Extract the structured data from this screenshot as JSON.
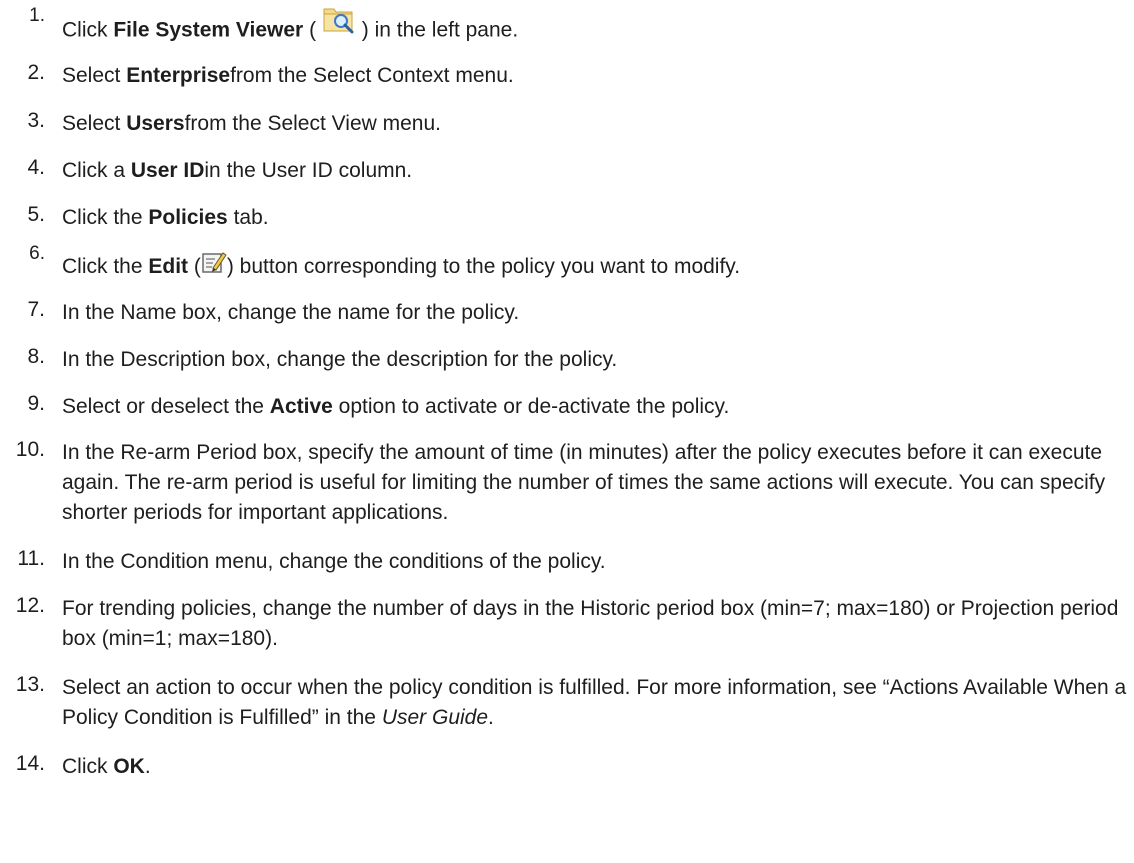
{
  "steps": [
    {
      "num": "1.",
      "before": "Click ",
      "bold": "File System Viewer",
      "middle": " ( ",
      "icon": "folder-magnifier-icon",
      "after": " ) in the left pane."
    },
    {
      "num": "2.",
      "before": "Select ",
      "bold": "Enterprise",
      "after": "from the Select Context menu."
    },
    {
      "num": "3.",
      "before": "Select ",
      "bold": "Users",
      "after": "from the Select View menu."
    },
    {
      "num": "4.",
      "before": "Click a ",
      "bold": "User ID",
      "after": "in the User ID column."
    },
    {
      "num": "5.",
      "before": "Click the ",
      "bold": "Policies",
      "after": " tab."
    },
    {
      "num": "6.",
      "before": "Click the ",
      "bold": "Edit",
      "middle": " (",
      "icon": "edit-pencil-icon",
      "after": ") button corresponding to the policy you want to modify."
    },
    {
      "num": "7.",
      "text": "In the Name box, change the name for the policy."
    },
    {
      "num": "8.",
      "text": "In the Description box, change the description for the policy."
    },
    {
      "num": "9.",
      "before": "Select or deselect the ",
      "bold": "Active",
      "after": " option to activate or de-activate the policy."
    },
    {
      "num": "10.",
      "text": "In the Re-arm Period box, specify the amount of time (in minutes) after the policy executes before it can execute again. The re-arm period is useful for limiting the number of times the same actions will execute. You can specify shorter periods for important applications."
    },
    {
      "num": "11.",
      "text": "In the Condition menu, change the conditions of the policy."
    },
    {
      "num": "12.",
      "text": "For trending policies, change the number of days in the Historic period box (min=7; max=180) or Projection period box (min=1; max=180)."
    },
    {
      "num": "13.",
      "before": "Select an action to occur when the policy condition is fulfilled. For more information, see “Actions Available When a Policy Condition is Fulfilled” in the ",
      "italic": "User Guide",
      "after": "."
    },
    {
      "num": "14.",
      "before": "Click ",
      "bold": "OK",
      "after": "."
    }
  ]
}
